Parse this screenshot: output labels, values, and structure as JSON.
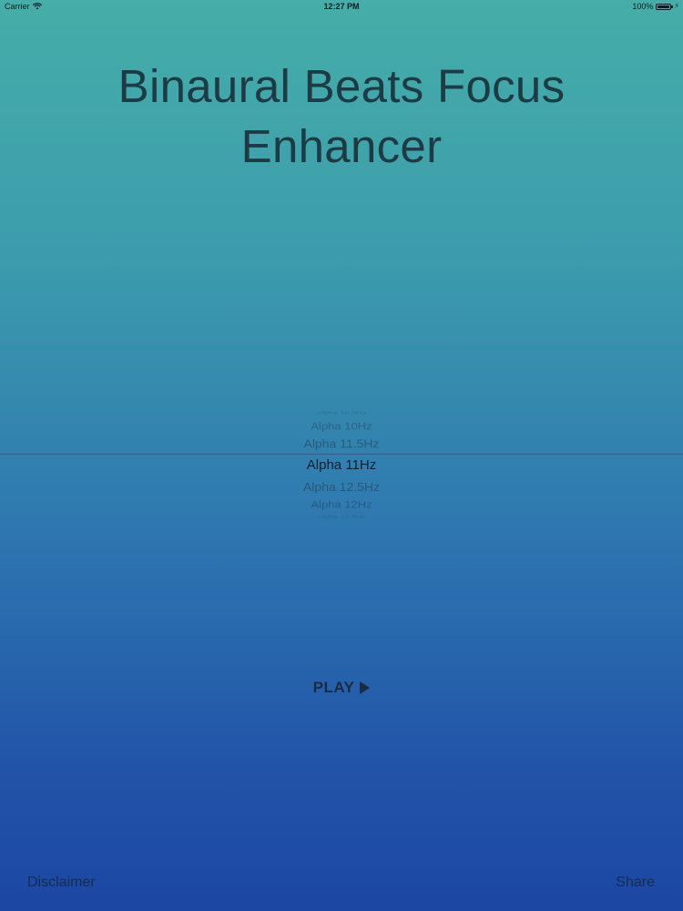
{
  "status_bar": {
    "carrier": "Carrier",
    "time": "12:27 PM",
    "battery_text": "100%",
    "battery_level": 1.0
  },
  "title": "Binaural Beats Focus Enhancer",
  "picker": {
    "items": [
      "Alpha 10.5Hz",
      "Alpha 10Hz",
      "Alpha 11.5Hz",
      "Alpha 11Hz",
      "Alpha 12.5Hz",
      "Alpha 12Hz",
      "Alpha 13.5Hz"
    ],
    "selected": "Alpha 11Hz"
  },
  "play": {
    "label": "PLAY",
    "icon": "play-triangle-icon"
  },
  "footer": {
    "disclaimer": "Disclaimer",
    "share": "Share"
  },
  "colors": {
    "gradient_top": "#46ada8",
    "gradient_bottom": "#1c47a4",
    "title_text": "#1d3b45"
  }
}
